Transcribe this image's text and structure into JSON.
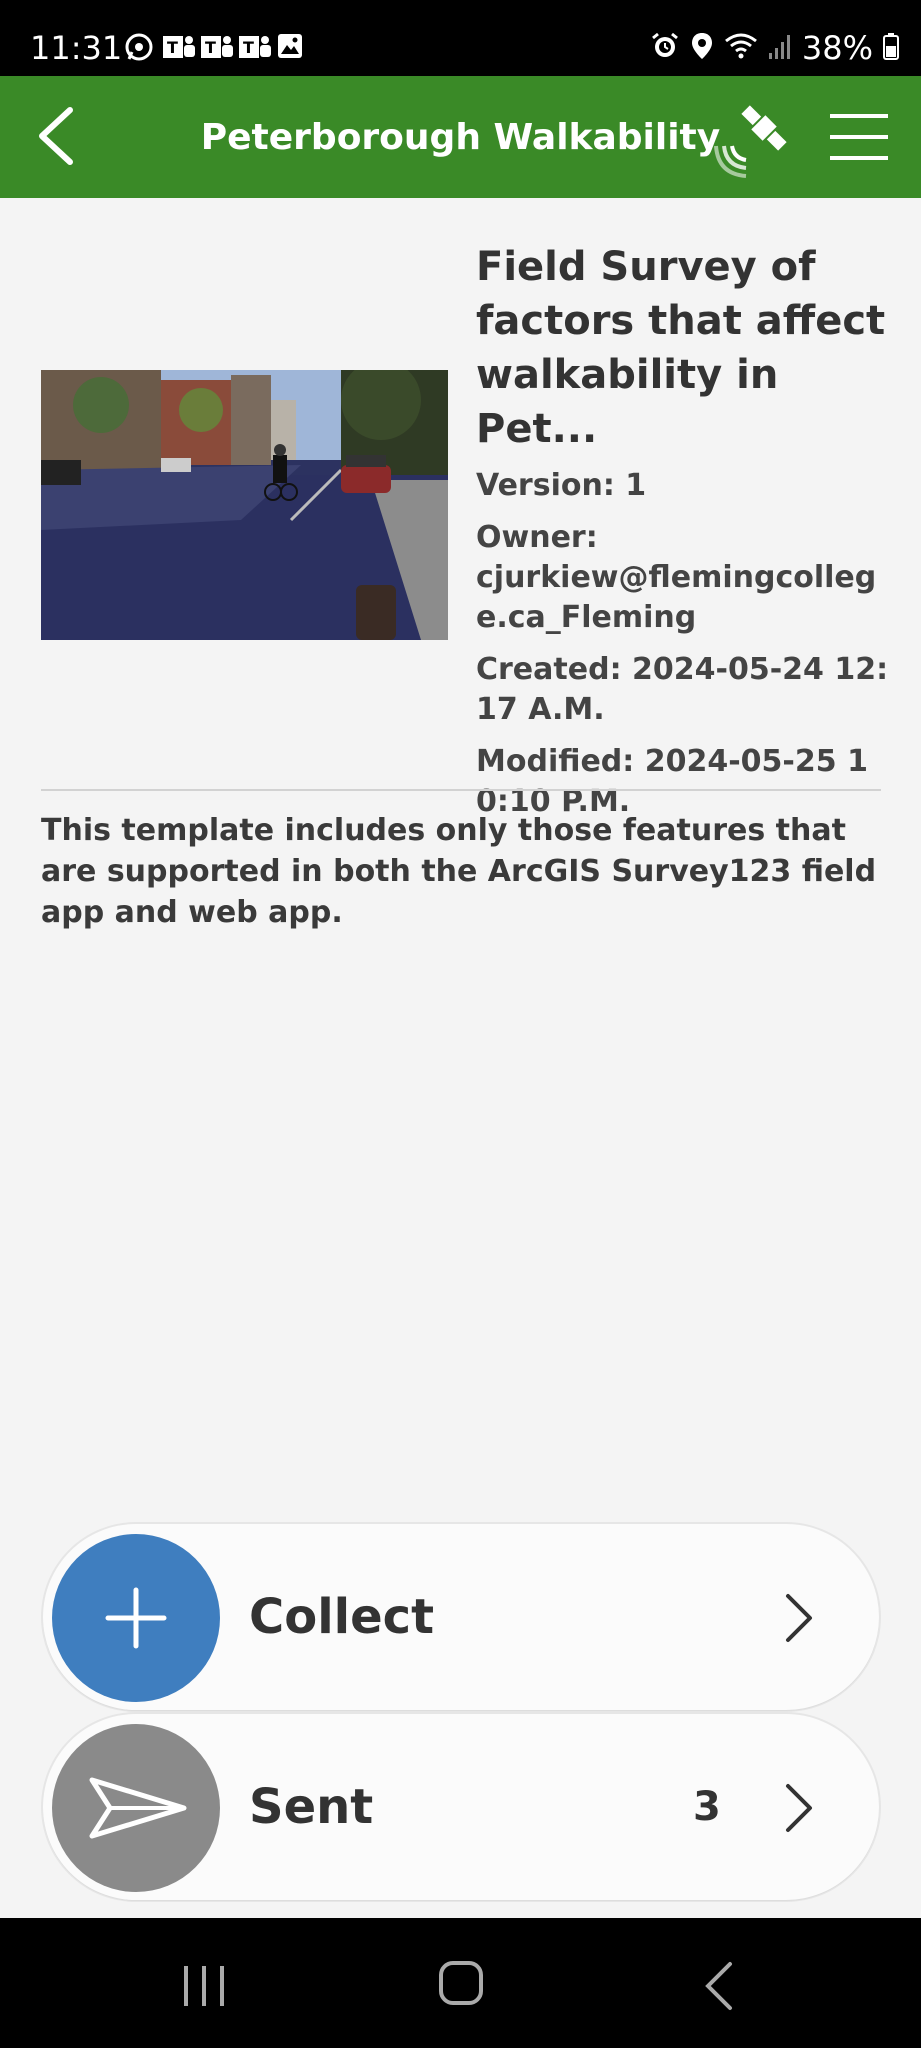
{
  "status_bar": {
    "time": "11:31",
    "battery": "38%",
    "notification_icons": [
      "whatsapp-icon",
      "teams-icon",
      "teams-icon",
      "teams-icon",
      "gallery-icon"
    ],
    "system_icons": [
      "alarm-icon",
      "location-icon",
      "wifi-icon",
      "signal-icon",
      "battery-icon"
    ]
  },
  "header": {
    "title": "Peterborough Walkability",
    "accent_color": "#3a8a27"
  },
  "survey": {
    "title": "Field Survey of factors that affect walkability in Pet...",
    "version_label": "Version:",
    "version": "1",
    "owner_label": "Owner:",
    "owner": "cjurkiew@flemingcollege.ca_Fleming",
    "created_label": "Created:",
    "created": "2024-05-24 12:17 A.M.",
    "modified_label": "Modified:",
    "modified": "2024-05-25 10:10 P.M.",
    "description": "This template includes only those features that are supported in both the ArcGIS Survey123 field app and web app."
  },
  "actions": {
    "collect": {
      "label": "Collect",
      "color": "#3f7ebf"
    },
    "sent": {
      "label": "Sent",
      "count": "3",
      "color": "#8a8a8a"
    }
  }
}
